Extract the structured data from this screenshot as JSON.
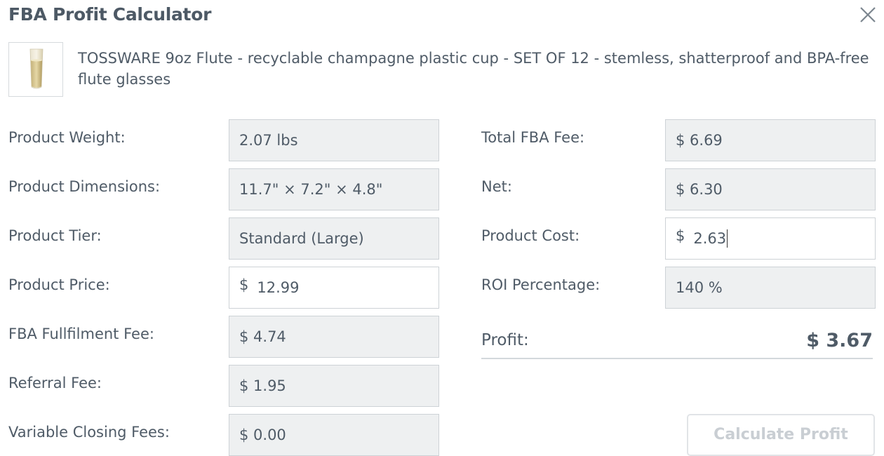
{
  "dialog": {
    "title": "FBA Profit Calculator"
  },
  "product": {
    "name": "TOSSWARE 9oz Flute - recyclable champagne plastic cup - SET OF 12 - stemless, shatterproof and BPA-free flute glasses"
  },
  "left_fields": {
    "weight": {
      "label": "Product Weight:",
      "value": "2.07 lbs"
    },
    "dimensions": {
      "label": "Product Dimensions:",
      "value": "11.7\" × 7.2\" × 4.8\""
    },
    "tier": {
      "label": "Product Tier:",
      "value": "Standard (Large)"
    },
    "price": {
      "label": "Product Price:",
      "currency": "$",
      "value": "12.99"
    },
    "fulfilment_fee": {
      "label": "FBA Fullfilment Fee:",
      "value": "$ 4.74"
    },
    "referral_fee": {
      "label": "Referral Fee:",
      "value": "$ 1.95"
    },
    "closing_fees": {
      "label": "Variable Closing Fees:",
      "value": "$ 0.00"
    }
  },
  "right_fields": {
    "total_fee": {
      "label": "Total FBA Fee:",
      "value": "$ 6.69"
    },
    "net": {
      "label": "Net:",
      "value": "$ 6.30"
    },
    "cost": {
      "label": "Product Cost:",
      "currency": "$",
      "value": "2.63"
    },
    "roi": {
      "label": "ROI Percentage:",
      "value": "140 %"
    }
  },
  "profit": {
    "label": "Profit:",
    "value": "$ 3.67"
  },
  "calculate_button": {
    "label": "Calculate Profit"
  },
  "icons": {
    "close": "close-icon",
    "product_thumbnail": "champagne-flute-image"
  },
  "colors": {
    "text": "#4f5b67",
    "readonly_bg": "#eef0f1",
    "border": "#cdd2d6",
    "disabled_button_text": "#c9ced3"
  }
}
